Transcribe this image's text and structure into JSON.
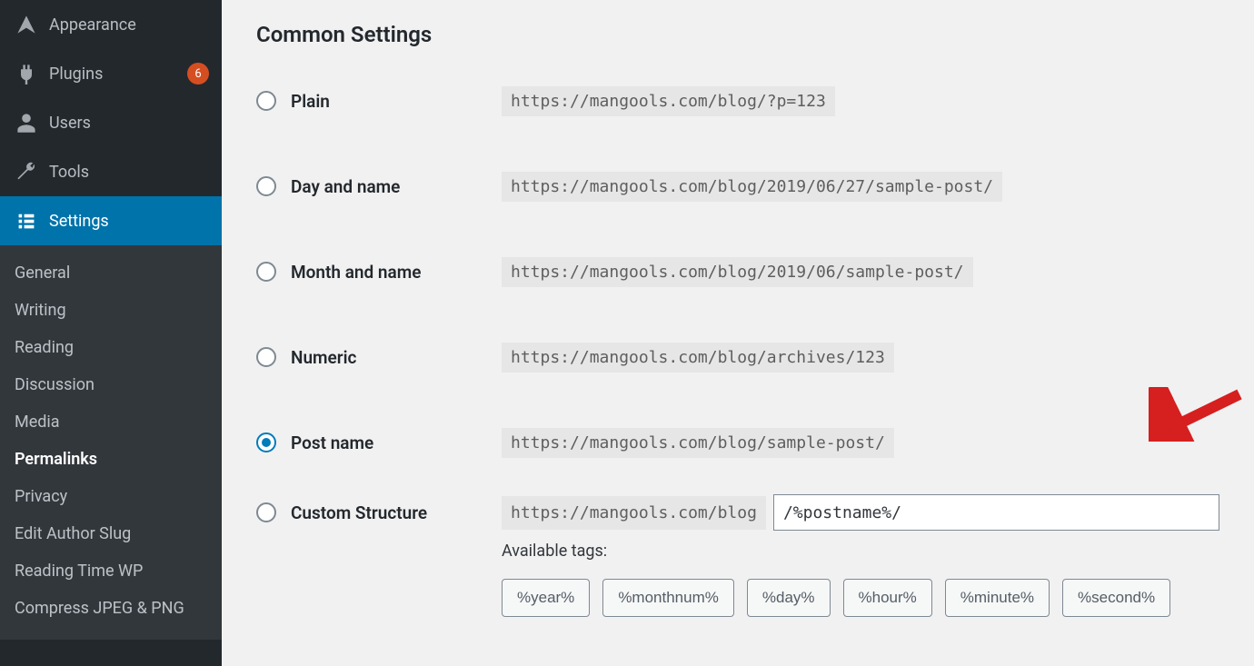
{
  "sidebar": {
    "items": [
      {
        "label": "Appearance",
        "icon": "appearance"
      },
      {
        "label": "Plugins",
        "icon": "plugins",
        "badge": "6"
      },
      {
        "label": "Users",
        "icon": "users"
      },
      {
        "label": "Tools",
        "icon": "tools"
      },
      {
        "label": "Settings",
        "icon": "settings",
        "active": true
      }
    ],
    "submenu": [
      "General",
      "Writing",
      "Reading",
      "Discussion",
      "Media",
      "Permalinks",
      "Privacy",
      "Edit Author Slug",
      "Reading Time WP",
      "Compress JPEG & PNG"
    ],
    "current_submenu": "Permalinks"
  },
  "page": {
    "heading": "Common Settings",
    "options": [
      {
        "key": "plain",
        "label": "Plain",
        "sample": "https://mangools.com/blog/?p=123"
      },
      {
        "key": "day",
        "label": "Day and name",
        "sample": "https://mangools.com/blog/2019/06/27/sample-post/"
      },
      {
        "key": "month",
        "label": "Month and name",
        "sample": "https://mangools.com/blog/2019/06/sample-post/"
      },
      {
        "key": "numeric",
        "label": "Numeric",
        "sample": "https://mangools.com/blog/archives/123"
      },
      {
        "key": "postname",
        "label": "Post name",
        "sample": "https://mangools.com/blog/sample-post/",
        "selected": true
      }
    ],
    "custom": {
      "label": "Custom Structure",
      "base": "https://mangools.com/blog",
      "value": "/%postname%/"
    },
    "available_tags_label": "Available tags:",
    "tags": [
      "%year%",
      "%monthnum%",
      "%day%",
      "%hour%",
      "%minute%",
      "%second%"
    ]
  },
  "colors": {
    "accent": "#0073aa",
    "arrow": "#d61f1f"
  }
}
